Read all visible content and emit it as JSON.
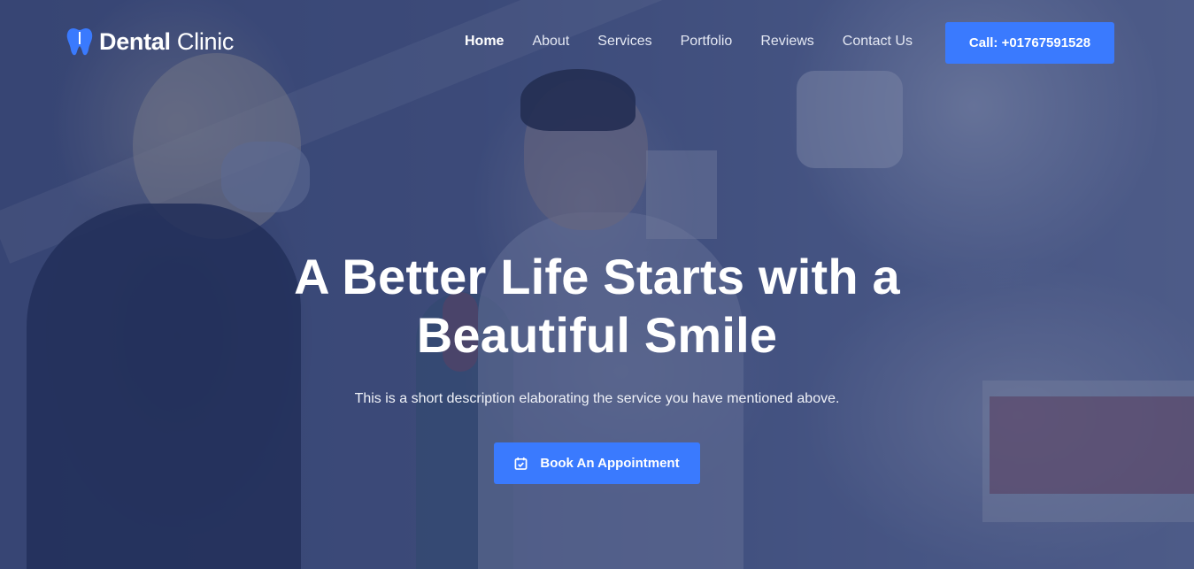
{
  "brand": {
    "name_bold": "Dental",
    "name_light": "Clinic",
    "icon": "tooth-icon",
    "accent_color": "#3a7afe"
  },
  "nav": {
    "items": [
      {
        "label": "Home",
        "active": true
      },
      {
        "label": "About",
        "active": false
      },
      {
        "label": "Services",
        "active": false
      },
      {
        "label": "Portfolio",
        "active": false
      },
      {
        "label": "Reviews",
        "active": false
      },
      {
        "label": "Contact Us",
        "active": false
      }
    ]
  },
  "header": {
    "call_label": "Call: +01767591528"
  },
  "hero": {
    "title": "A Better Life Starts with a Beautiful Smile",
    "description": "This is a short description elaborating the service you have mentioned above.",
    "cta_label": "Book An Appointment",
    "cta_icon": "calendar-check-icon"
  }
}
